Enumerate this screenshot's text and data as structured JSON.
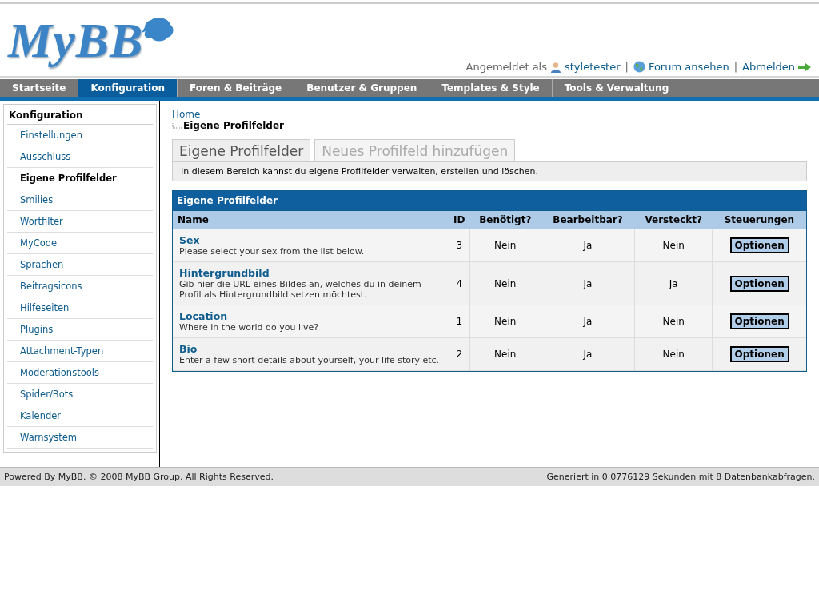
{
  "logo": "MyBB",
  "user_bar": {
    "prefix": "Angemeldet als",
    "username": "styletester",
    "view_forum": "Forum ansehen",
    "logout": "Abmelden",
    "separator": "|"
  },
  "nav_tabs": [
    {
      "label": "Startseite",
      "selected": false
    },
    {
      "label": "Konfiguration",
      "selected": true
    },
    {
      "label": "Foren & Beiträge",
      "selected": false
    },
    {
      "label": "Benutzer & Gruppen",
      "selected": false
    },
    {
      "label": "Templates & Style",
      "selected": false
    },
    {
      "label": "Tools & Verwaltung",
      "selected": false
    }
  ],
  "sidebar": {
    "title": "Konfiguration",
    "items": [
      {
        "label": "Einstellungen",
        "selected": false
      },
      {
        "label": "Ausschluss",
        "selected": false
      },
      {
        "label": "Eigene Profilfelder",
        "selected": true
      },
      {
        "label": "Smilies",
        "selected": false
      },
      {
        "label": "Wortfilter",
        "selected": false
      },
      {
        "label": "MyCode",
        "selected": false
      },
      {
        "label": "Sprachen",
        "selected": false
      },
      {
        "label": "Beitragsicons",
        "selected": false
      },
      {
        "label": "Hilfeseiten",
        "selected": false
      },
      {
        "label": "Plugins",
        "selected": false
      },
      {
        "label": "Attachment-Typen",
        "selected": false
      },
      {
        "label": "Moderationstools",
        "selected": false
      },
      {
        "label": "Spider/Bots",
        "selected": false
      },
      {
        "label": "Kalender",
        "selected": false
      },
      {
        "label": "Warnsystem",
        "selected": false
      }
    ]
  },
  "breadcrumb": {
    "home": "Home",
    "current": "Eigene Profilfelder"
  },
  "sub_tabs": [
    {
      "label": "Eigene Profilfelder",
      "selected": true
    },
    {
      "label": "Neues Profilfeld hinzufügen",
      "selected": false
    }
  ],
  "description": "In diesem Bereich kannst du eigene Profilfelder verwalten, erstellen und löschen.",
  "table": {
    "title": "Eigene Profilfelder",
    "columns": [
      "Name",
      "ID",
      "Benötigt?",
      "Bearbeitbar?",
      "Versteckt?",
      "Steuerungen"
    ],
    "rows": [
      {
        "name": "Sex",
        "description": "Please select your sex from the list below.",
        "id": "3",
        "required": "Nein",
        "editable": "Ja",
        "hidden": "Nein",
        "action": "Optionen"
      },
      {
        "name": "Hintergrundbild",
        "description": "Gib hier die URL eines Bildes an, welches du in deinem Profil als Hintergrundbild setzen möchtest.",
        "id": "4",
        "required": "Nein",
        "editable": "Ja",
        "hidden": "Ja",
        "action": "Optionen"
      },
      {
        "name": "Location",
        "description": "Where in the world do you live?",
        "id": "1",
        "required": "Nein",
        "editable": "Ja",
        "hidden": "Nein",
        "action": "Optionen"
      },
      {
        "name": "Bio",
        "description": "Enter a few short details about yourself, your life story etc.",
        "id": "2",
        "required": "Nein",
        "editable": "Ja",
        "hidden": "Nein",
        "action": "Optionen"
      }
    ]
  },
  "footer": {
    "copyright": "Powered By MyBB. © 2008 MyBB Group. All Rights Reserved.",
    "stats": "Generiert in 0.0776129 Sekunden mit 8 Datenbankabfragen."
  }
}
